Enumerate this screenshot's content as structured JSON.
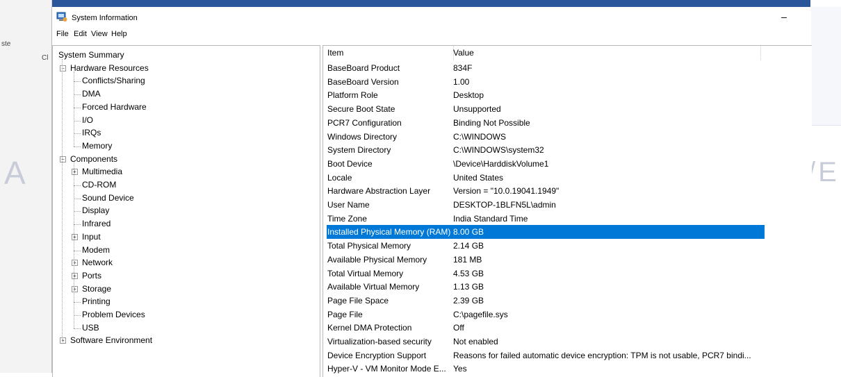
{
  "window": {
    "title": "System Information",
    "minimize": "–"
  },
  "background": {
    "left_labels": [
      "ste",
      "Cl"
    ],
    "watermark_left": "A",
    "watermark_right": "/E"
  },
  "menubar": {
    "items": [
      "File",
      "Edit",
      "View",
      "Help"
    ]
  },
  "tree": {
    "items": [
      {
        "label": "System Summary",
        "level": 0,
        "expander": "none"
      },
      {
        "label": "Hardware Resources",
        "level": 1,
        "expander": "minus"
      },
      {
        "label": "Conflicts/Sharing",
        "level": 2,
        "expander": "none"
      },
      {
        "label": "DMA",
        "level": 2,
        "expander": "none"
      },
      {
        "label": "Forced Hardware",
        "level": 2,
        "expander": "none"
      },
      {
        "label": "I/O",
        "level": 2,
        "expander": "none"
      },
      {
        "label": "IRQs",
        "level": 2,
        "expander": "none"
      },
      {
        "label": "Memory",
        "level": 2,
        "expander": "none"
      },
      {
        "label": "Components",
        "level": 1,
        "expander": "minus"
      },
      {
        "label": "Multimedia",
        "level": 2,
        "expander": "plus"
      },
      {
        "label": "CD-ROM",
        "level": 2,
        "expander": "none"
      },
      {
        "label": "Sound Device",
        "level": 2,
        "expander": "none"
      },
      {
        "label": "Display",
        "level": 2,
        "expander": "none"
      },
      {
        "label": "Infrared",
        "level": 2,
        "expander": "none"
      },
      {
        "label": "Input",
        "level": 2,
        "expander": "plus"
      },
      {
        "label": "Modem",
        "level": 2,
        "expander": "none"
      },
      {
        "label": "Network",
        "level": 2,
        "expander": "plus"
      },
      {
        "label": "Ports",
        "level": 2,
        "expander": "plus"
      },
      {
        "label": "Storage",
        "level": 2,
        "expander": "plus"
      },
      {
        "label": "Printing",
        "level": 2,
        "expander": "none"
      },
      {
        "label": "Problem Devices",
        "level": 2,
        "expander": "none"
      },
      {
        "label": "USB",
        "level": 2,
        "expander": "none"
      },
      {
        "label": "Software Environment",
        "level": 1,
        "expander": "plus"
      }
    ]
  },
  "list": {
    "columns": [
      "Item",
      "Value"
    ],
    "selected_index": 12,
    "rows": [
      [
        "BaseBoard Product",
        "834F"
      ],
      [
        "BaseBoard Version",
        "1.00"
      ],
      [
        "Platform Role",
        "Desktop"
      ],
      [
        "Secure Boot State",
        "Unsupported"
      ],
      [
        "PCR7 Configuration",
        "Binding Not Possible"
      ],
      [
        "Windows Directory",
        "C:\\WINDOWS"
      ],
      [
        "System Directory",
        "C:\\WINDOWS\\system32"
      ],
      [
        "Boot Device",
        "\\Device\\HarddiskVolume1"
      ],
      [
        "Locale",
        "United States"
      ],
      [
        "Hardware Abstraction Layer",
        "Version = \"10.0.19041.1949\""
      ],
      [
        "User Name",
        "DESKTOP-1BLFN5L\\admin"
      ],
      [
        "Time Zone",
        "India Standard Time"
      ],
      [
        "Installed Physical Memory (RAM)",
        "8.00 GB"
      ],
      [
        "Total Physical Memory",
        "2.14 GB"
      ],
      [
        "Available Physical Memory",
        "181 MB"
      ],
      [
        "Total Virtual Memory",
        "4.53 GB"
      ],
      [
        "Available Virtual Memory",
        "1.13 GB"
      ],
      [
        "Page File Space",
        "2.39 GB"
      ],
      [
        "Page File",
        "C:\\pagefile.sys"
      ],
      [
        "Kernel DMA Protection",
        "Off"
      ],
      [
        "Virtualization-based security",
        "Not enabled"
      ],
      [
        "Device Encryption Support",
        "Reasons for failed automatic device encryption: TPM is not usable, PCR7 bindi..."
      ],
      [
        "Hyper-V - VM Monitor Mode E...",
        "Yes"
      ]
    ]
  },
  "colors": {
    "selection": "#0078d7",
    "ribbon": "#2b579a"
  }
}
